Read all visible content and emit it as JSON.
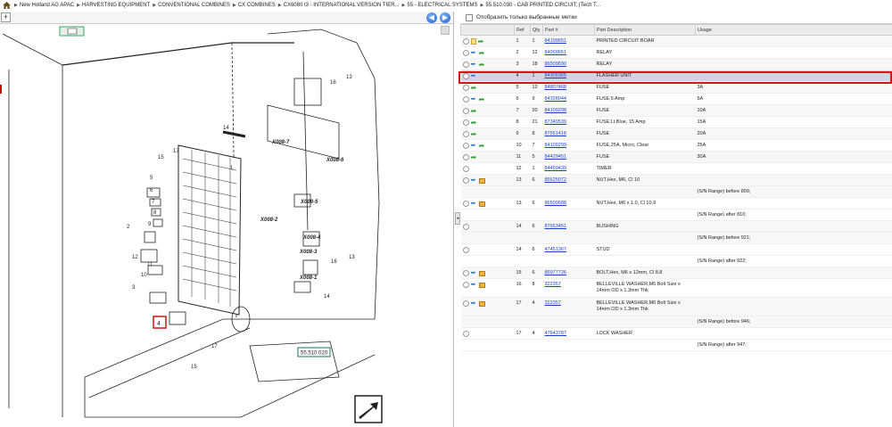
{
  "breadcrumb": [
    "New Holland AG APAC",
    "HARVESTING EQUIPMENT",
    "CONVENTIONAL COMBINES",
    "CX COMBINES",
    "CX6080 I3 - INTERNATIONAL VERSION TIER...",
    "55 - ELECTRICAL SYSTEMS",
    "55.510.030 - CAB PRINTED CIRCUIT; (Tech T..."
  ],
  "filter": {
    "label": "Отобразить только выбранные метки"
  },
  "zoom_symbol": "+",
  "nav": {
    "back": "◀",
    "forward": "▶"
  },
  "collapse_symbol": "◂",
  "columns": [
    "Ref",
    "Qty",
    "Part #",
    "Part Description",
    "Usage"
  ],
  "rows": [
    {
      "ref": "1",
      "qty": "1",
      "part": "84199651",
      "desc": "PRINTED CIRCUIT BOAR",
      "usage": "",
      "icons": [
        "circle",
        "doc",
        "green"
      ]
    },
    {
      "ref": "2",
      "qty": "12",
      "part": "84009651",
      "desc": "RELAY",
      "usage": "",
      "icons": [
        "circle",
        "blue",
        "green"
      ]
    },
    {
      "ref": "3",
      "qty": "18",
      "part": "86509590",
      "desc": "RELAY",
      "usage": "",
      "icons": [
        "circle",
        "blue",
        "green"
      ]
    },
    {
      "ref": "4",
      "qty": "1",
      "part": "84305365",
      "desc": "FLASHER UNIT",
      "usage": "",
      "icons": [
        "circle",
        "blue"
      ],
      "selected": true
    },
    {
      "ref": "5",
      "qty": "12",
      "part": "84807468",
      "desc": "FUSE",
      "usage": "3A",
      "icons": [
        "circle",
        "green"
      ]
    },
    {
      "ref": "6",
      "qty": "9",
      "part": "84328044",
      "desc": "FUSE,5 Amp",
      "usage": "5A",
      "icons": [
        "circle",
        "blue",
        "green"
      ]
    },
    {
      "ref": "7",
      "qty": "20",
      "part": "84109298",
      "desc": "FUSE",
      "usage": "10A",
      "icons": [
        "circle",
        "green"
      ]
    },
    {
      "ref": "8",
      "qty": "21",
      "part": "87349539",
      "desc": "FUSE,Lt Blue, 15 Amp",
      "usage": "15A",
      "icons": [
        "circle",
        "green"
      ]
    },
    {
      "ref": "9",
      "qty": "8",
      "part": "87551418",
      "desc": "FUSE",
      "usage": "20A",
      "icons": [
        "circle",
        "green"
      ]
    },
    {
      "ref": "10",
      "qty": "7",
      "part": "84109299",
      "desc": "FUSE,25A, Micro, Clear",
      "usage": "25A",
      "icons": [
        "circle",
        "blue",
        "green"
      ]
    },
    {
      "ref": "11",
      "qty": "5",
      "part": "84429451",
      "desc": "FUSE",
      "usage": "30A",
      "icons": [
        "circle",
        "green"
      ]
    },
    {
      "ref": "12",
      "qty": "1",
      "part": "84459439",
      "desc": "TIMER",
      "usage": "",
      "icons": [
        "circle"
      ]
    },
    {
      "ref": "13",
      "qty": "6",
      "part": "86625072",
      "desc": "NUT,Hex, M6, Cl 10",
      "usage": "",
      "icons": [
        "circle",
        "blue",
        "box"
      ]
    },
    {
      "sub": true,
      "usage": "(S/N Range) before 809;"
    },
    {
      "ref": "13",
      "qty": "6",
      "part": "86509688",
      "desc": "NUT,Hex, M6 x 1.0, Cl 10.9",
      "usage": "",
      "icons": [
        "circle",
        "blue",
        "box"
      ]
    },
    {
      "sub": true,
      "usage": "(S/N Range) after 810;"
    },
    {
      "ref": "14",
      "qty": "6",
      "part": "87653451",
      "desc": "BUSHING",
      "usage": "",
      "icons": [
        "circle"
      ]
    },
    {
      "sub": true,
      "usage": "(S/N Range) before 921;"
    },
    {
      "ref": "14",
      "qty": "6",
      "part": "47451367",
      "desc": "STUD",
      "usage": "",
      "icons": [
        "circle"
      ]
    },
    {
      "sub": true,
      "usage": "(S/N Range) after 922;"
    },
    {
      "ref": "15",
      "qty": "6",
      "part": "86977726",
      "desc": "BOLT,Hex, M6 x 12mm, Cl 8.8",
      "usage": "",
      "icons": [
        "circle",
        "blue",
        "box"
      ]
    },
    {
      "ref": "16",
      "qty": "8",
      "part": "322357",
      "desc": "BELLEVILLE WASHER,M6 Bolt Size x 14mm OD x 1.3mm Thk",
      "usage": "",
      "icons": [
        "circle",
        "blue",
        "box"
      ],
      "tall": true
    },
    {
      "ref": "17",
      "qty": "4",
      "part": "322357",
      "desc": "BELLEVILLE WASHER,M6 Bolt Size x 14mm OD x 1.3mm Thk",
      "usage": "",
      "icons": [
        "circle",
        "blue",
        "box"
      ],
      "tall": true
    },
    {
      "sub": true,
      "usage": "(S/N Range) before 946;"
    },
    {
      "ref": "17",
      "qty": "4",
      "part": "47643787",
      "desc": "LOCK WASHER",
      "usage": "",
      "icons": [
        "circle"
      ]
    },
    {
      "sub": true,
      "usage": "(S/N Range) after 947;"
    }
  ],
  "diagram": {
    "callouts": [
      "1",
      "2",
      "3",
      "4",
      "5",
      "6",
      "7",
      "8",
      "9",
      "10",
      "11",
      "12",
      "13",
      "14",
      "15",
      "16",
      "17"
    ],
    "connector_labels": [
      "X008-7",
      "X008-6",
      "X008-5",
      "X008-2",
      "X008-4",
      "X008-3",
      "X008-1"
    ],
    "section_tag": "55.510.020",
    "highlight_ref": "4"
  }
}
